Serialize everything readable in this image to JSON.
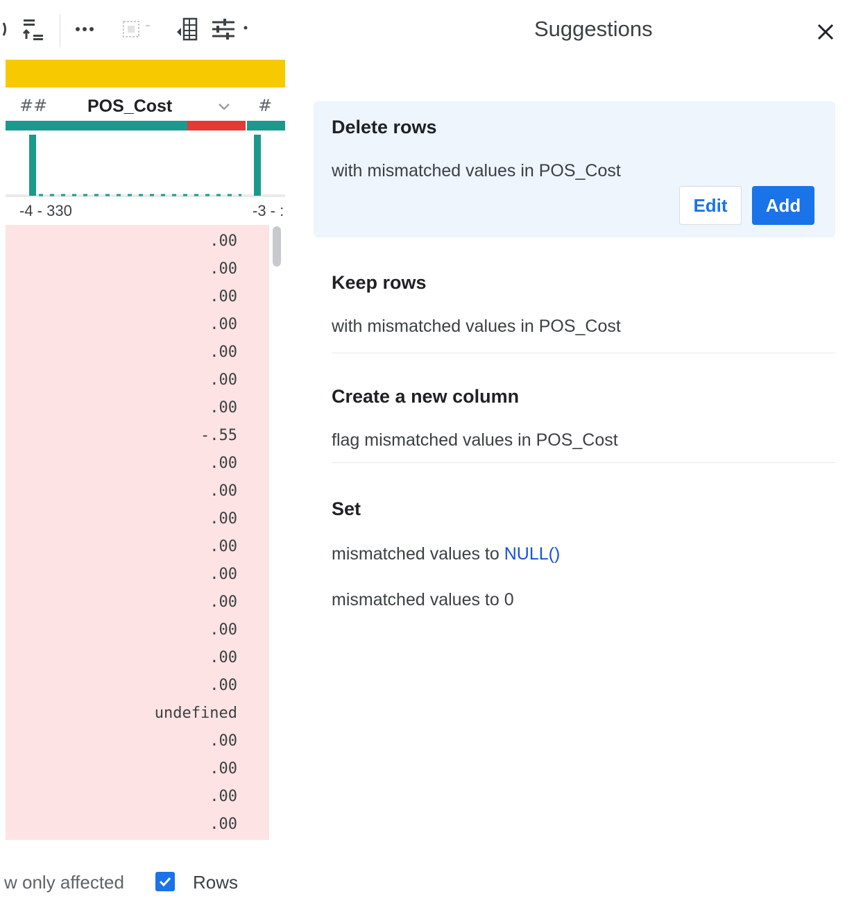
{
  "grid": {
    "toolbar": {
      "items": [
        {
          "name": "sort-icon"
        },
        {
          "name": "more-icon"
        },
        {
          "name": "selection-icon"
        },
        {
          "name": "column-details-icon"
        },
        {
          "name": "filter-settings-icon"
        }
      ]
    },
    "column": {
      "left_type_icon": "##",
      "name": "POS_Cost",
      "right_type_icon": "#"
    },
    "quality": {
      "valid_fraction": 0.65,
      "mismatched_fraction": 0.21,
      "colors": {
        "valid": "#1b9a8c",
        "mismatched": "#e53935",
        "cell_bg": "#fde3e3"
      }
    },
    "range": {
      "min_label": "-4 - 330",
      "next_label": "-3 - :"
    },
    "cells": [
      ".00",
      ".00",
      ".00",
      ".00",
      ".00",
      ".00",
      ".00",
      "-.55",
      ".00",
      ".00",
      ".00",
      ".00",
      ".00",
      ".00",
      ".00",
      ".00",
      ".00",
      "undefined",
      ".00",
      ".00",
      ".00",
      ".00"
    ],
    "footer": {
      "label": "w only affected",
      "checkbox_checked": true,
      "rows_label": "Rows"
    }
  },
  "panel": {
    "title": "Suggestions",
    "delete": {
      "title": "Delete rows",
      "desc_prefix": "with mismatched values in ",
      "desc_column": "POS_Cost",
      "edit_label": "Edit",
      "add_label": "Add"
    },
    "keep": {
      "title": "Keep rows",
      "desc_prefix": "with mismatched values in ",
      "desc_column": "POS_Cost"
    },
    "new_column": {
      "title": "Create a new column",
      "desc_prefix": "flag mismatched values in ",
      "desc_column": "POS_Cost"
    },
    "set": {
      "title": "Set",
      "option1_prefix": "mismatched values to ",
      "option1_fn": "NULL()",
      "option2": "mismatched values to 0"
    }
  }
}
